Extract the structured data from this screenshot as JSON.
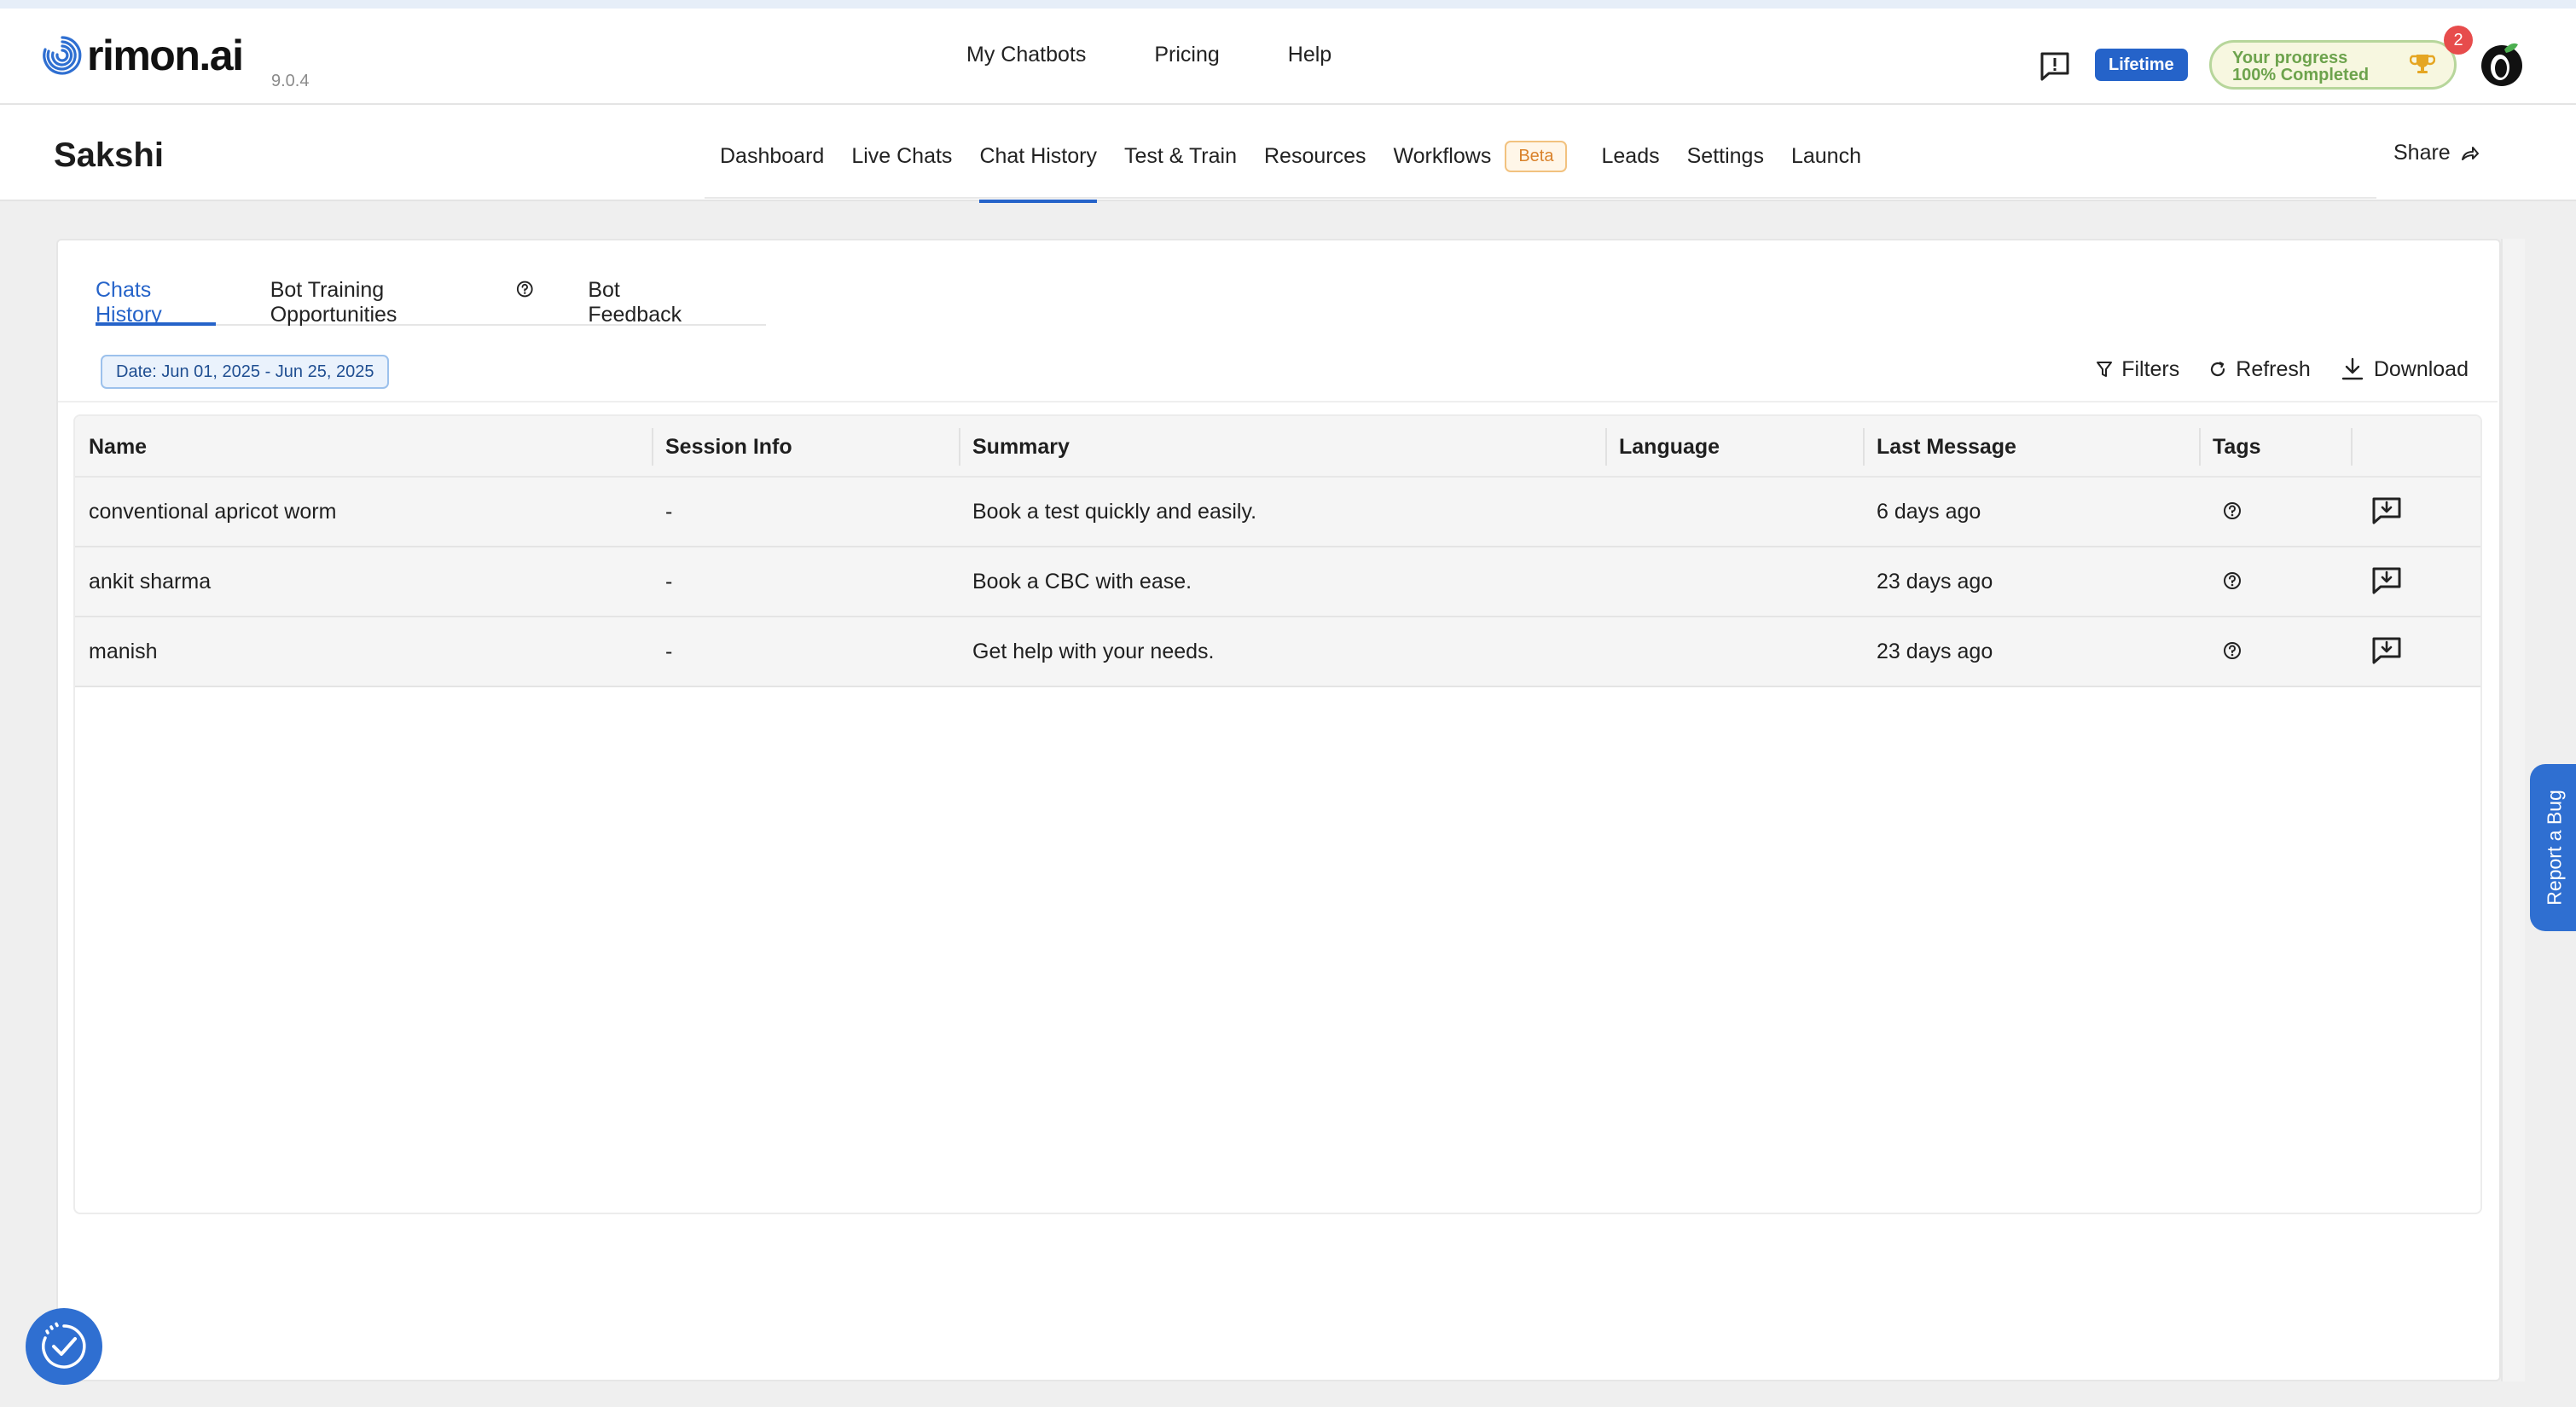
{
  "brand": {
    "name": "rimon.ai",
    "version": "9.0.4"
  },
  "topnav": {
    "items": [
      "My Chatbots",
      "Pricing",
      "Help"
    ]
  },
  "header_right": {
    "plan_label": "Lifetime",
    "progress_line1": "Your progress",
    "progress_line2": "100% Completed",
    "notification_count": "2"
  },
  "bot": {
    "name": "Sakshi"
  },
  "bot_tabs": {
    "dashboard": "Dashboard",
    "live_chats": "Live Chats",
    "chat_history": "Chat History",
    "test_train": "Test & Train",
    "resources": "Resources",
    "workflows": "Workflows",
    "beta": "Beta",
    "leads": "Leads",
    "settings": "Settings",
    "launch": "Launch",
    "active": "Chat History"
  },
  "share_label": "Share",
  "inner_tabs": {
    "chats_history": "Chats History",
    "bot_training": "Bot Training Opportunities",
    "bot_feedback": "Bot Feedback"
  },
  "date_filter": "Date: Jun 01, 2025 - Jun 25, 2025",
  "actions": {
    "filters": "Filters",
    "refresh": "Refresh",
    "download": "Download"
  },
  "table": {
    "columns": [
      "Name",
      "Session Info",
      "Summary",
      "Language",
      "Last Message",
      "Tags"
    ],
    "rows": [
      {
        "name": "conventional apricot worm",
        "session": "-",
        "summary": "Book a test quickly and easily.",
        "language": "",
        "last_message": "6 days ago"
      },
      {
        "name": "ankit sharma",
        "session": "-",
        "summary": "Book a CBC with ease.",
        "language": "",
        "last_message": "23 days ago"
      },
      {
        "name": "manish",
        "session": "-",
        "summary": "Get help with your needs.",
        "language": "",
        "last_message": "23 days ago"
      }
    ]
  },
  "report_bug": "Report a Bug",
  "colors": {
    "accent": "#2563c9",
    "beta": "#d9822b",
    "progress": "#6da34d",
    "badge": "#e74c4c"
  }
}
